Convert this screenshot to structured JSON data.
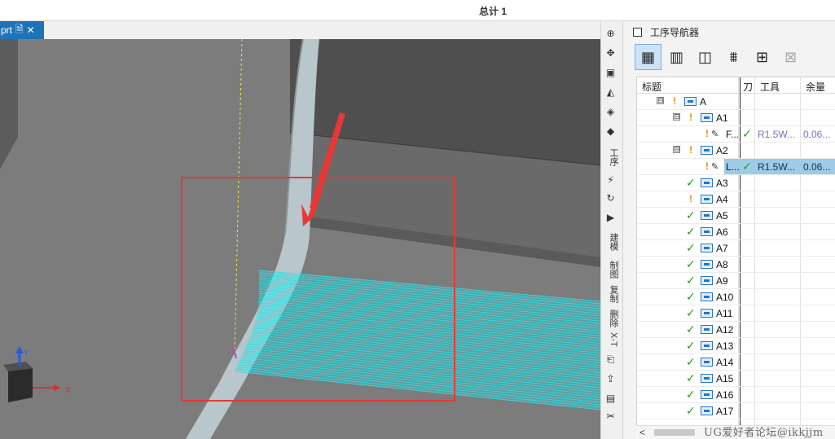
{
  "window": {
    "title": "总计 1"
  },
  "tab": {
    "label": "prt",
    "icon": "document-icon",
    "close": "✕"
  },
  "viewport": {
    "triad": {
      "z_label": "Z",
      "y_label": "Y",
      "x_label": "X"
    },
    "colors": {
      "background": "#7c7c7c",
      "toolpath": "#2fe0e6",
      "highlight_box": "#e53935",
      "arrow": "#e53935"
    }
  },
  "vertical_toolbar": {
    "labels": [
      "工序",
      "建模",
      "制图",
      "复制",
      "删除",
      "X-T"
    ]
  },
  "navigator": {
    "title": "工序导航器",
    "columns": {
      "name": "标题",
      "flag": "刀",
      "tool": "工具",
      "stock": "余量"
    },
    "rows": [
      {
        "name": "A",
        "level": 0,
        "status": "warn",
        "fold": "⊟"
      },
      {
        "name": "A1",
        "level": 1,
        "status": "warn",
        "fold": "⊟"
      },
      {
        "name": "F...",
        "level": 2,
        "status": "warn",
        "type": "op",
        "check": "✓",
        "tool": "R1.5W...",
        "stock": "0.06..."
      },
      {
        "name": "A2",
        "level": 1,
        "status": "warn",
        "fold": "⊟"
      },
      {
        "name": "L...",
        "level": 2,
        "status": "warn",
        "type": "op",
        "check": "✓",
        "tool": "R1.5W...",
        "stock": "0.06...",
        "selected": true
      },
      {
        "name": "A3",
        "level": 1,
        "status": "ok"
      },
      {
        "name": "A4",
        "level": 1,
        "status": "warn"
      },
      {
        "name": "A5",
        "level": 1,
        "status": "ok"
      },
      {
        "name": "A6",
        "level": 1,
        "status": "ok"
      },
      {
        "name": "A7",
        "level": 1,
        "status": "ok"
      },
      {
        "name": "A8",
        "level": 1,
        "status": "ok"
      },
      {
        "name": "A9",
        "level": 1,
        "status": "ok"
      },
      {
        "name": "A10",
        "level": 1,
        "status": "ok"
      },
      {
        "name": "A11",
        "level": 1,
        "status": "ok"
      },
      {
        "name": "A12",
        "level": 1,
        "status": "ok"
      },
      {
        "name": "A13",
        "level": 1,
        "status": "ok"
      },
      {
        "name": "A14",
        "level": 1,
        "status": "ok"
      },
      {
        "name": "A15",
        "level": 1,
        "status": "ok"
      },
      {
        "name": "A16",
        "level": 1,
        "status": "ok"
      },
      {
        "name": "A17",
        "level": 1,
        "status": "ok"
      }
    ]
  },
  "watermark": "UG爱好者论坛@ikkjjm"
}
